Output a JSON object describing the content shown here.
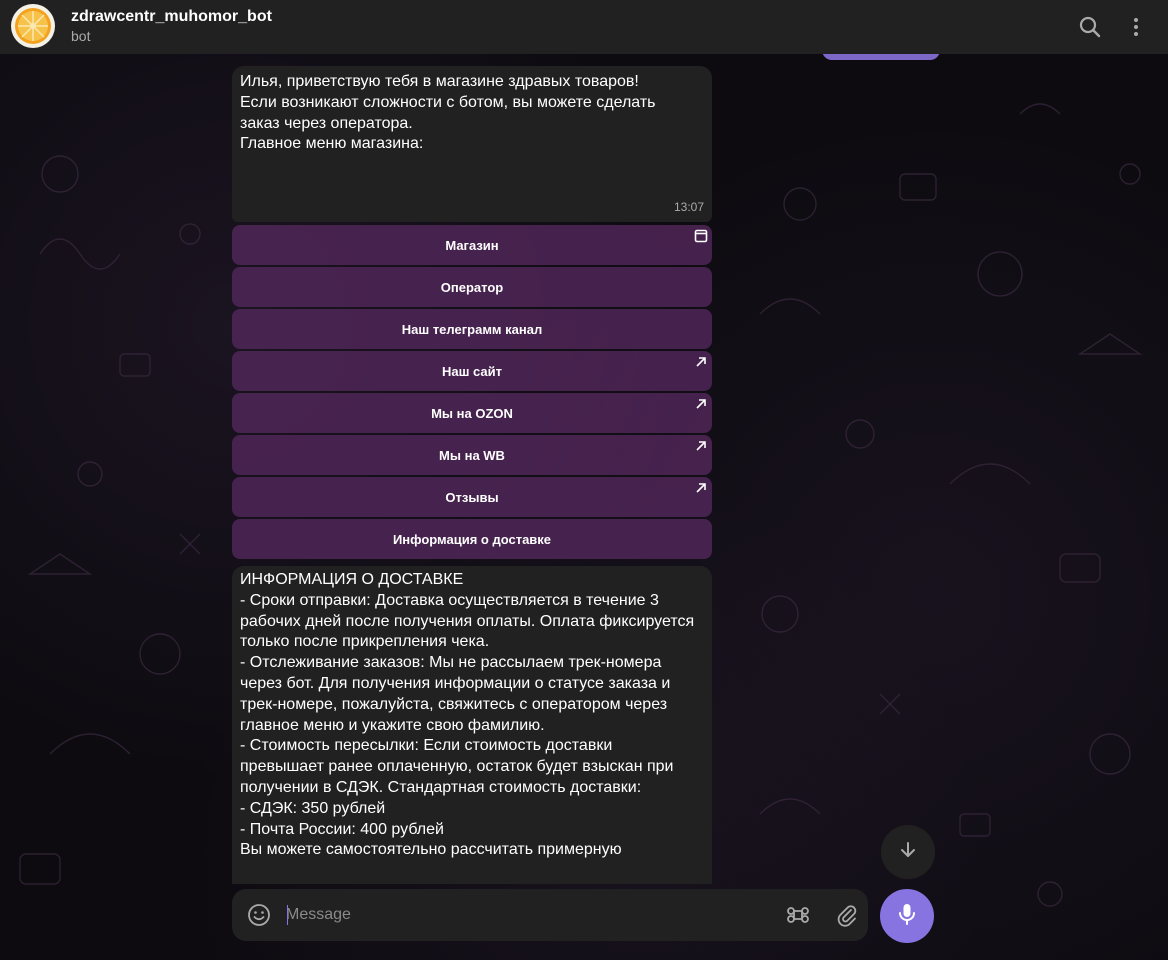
{
  "header": {
    "title": "zdrawcentr_muhomor_bot",
    "subtitle": "bot"
  },
  "message1": {
    "lines": [
      "Илья, приветствую тебя в магазине здравых товаров!",
      "",
      "",
      "Если возникают сложности с ботом, вы можете сделать",
      "заказ через оператора.",
      "",
      "Главное меню магазина:"
    ],
    "time": "13:07"
  },
  "keyboard": [
    {
      "label": "Магазин",
      "icon": "web-app-icon"
    },
    {
      "label": "Оператор",
      "icon": ""
    },
    {
      "label": "Наш телеграмм канал",
      "icon": ""
    },
    {
      "label": "Наш сайт",
      "icon": "external-link-icon"
    },
    {
      "label": "Мы на OZON",
      "icon": "external-link-icon"
    },
    {
      "label": "Мы на WB",
      "icon": "external-link-icon"
    },
    {
      "label": "Отзывы",
      "icon": "external-link-icon"
    },
    {
      "label": "Информация о доставке",
      "icon": ""
    }
  ],
  "message2": {
    "lines": [
      "ИНФОРМАЦИЯ О ДОСТАВКЕ",
      "- Сроки отправки: Доставка осуществляется в течение 3",
      "рабочих дней после получения оплаты. Оплата фиксируется",
      "только после прикрепления чека.",
      "- Отслеживание заказов: Мы не рассылаем трек-номера",
      "через бот. Для получения информации о статусе заказа и",
      "трек-номере, пожалуйста, свяжитесь с оператором через",
      "главное меню и укажите свою фамилию.",
      "- Стоимость пересылки: Если стоимость доставки",
      "превышает ранее оплаченную, остаток будет взыскан при",
      "получении в СДЭК. Стандартная стоимость доставки:",
      "- СДЭК: 350 рублей",
      "- Почта России: 400 рублей",
      "",
      "Вы можете самостоятельно рассчитать примерную"
    ]
  },
  "composer": {
    "placeholder": "Message"
  },
  "colors": {
    "accent": "#8774e1",
    "bubble": "#212121",
    "keyboard_button": "#54285e",
    "header": "#212121"
  }
}
